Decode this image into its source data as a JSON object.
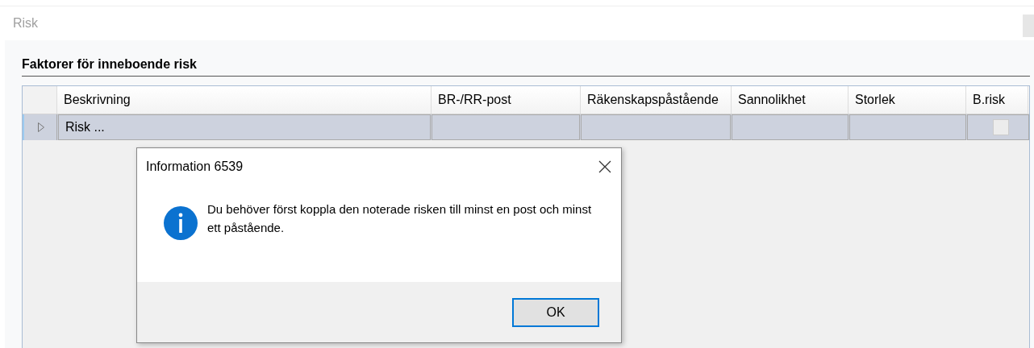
{
  "page_title": "Risk",
  "section_title": "Faktorer för inneboende risk",
  "table": {
    "columns": [
      "Beskrivning",
      "BR-/RR-post",
      "Räkenskapspåstående",
      "Sannolikhet",
      "Storlek",
      "B.risk"
    ],
    "rows": [
      {
        "expanded": false,
        "selected": true,
        "cells": [
          "Risk ...",
          "",
          "",
          "",
          ""
        ],
        "b_risk": false
      }
    ]
  },
  "dialog": {
    "title": "Information 6539",
    "message": "Du behöver först koppla den noterade risken till minst en post och minst ett påstående.",
    "buttons": [
      "OK"
    ]
  }
}
